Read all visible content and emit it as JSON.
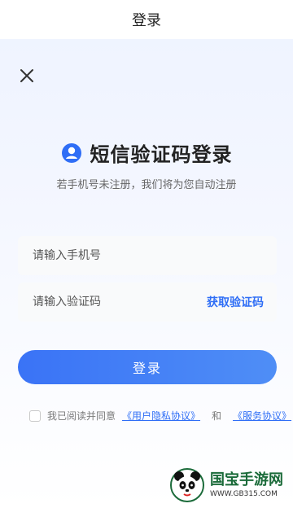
{
  "header": {
    "title": "登录"
  },
  "hero": {
    "title": "短信验证码登录",
    "subtitle": "若手机号未注册，我们将为您自动注册"
  },
  "form": {
    "phone_placeholder": "请输入手机号",
    "code_placeholder": "请输入验证码",
    "get_code_label": "获取验证码",
    "login_label": "登录"
  },
  "agreement": {
    "prefix": "我已阅读并同意",
    "privacy_link": "《用户隐私协议》",
    "and_text": "和",
    "service_link": "《服务协议》",
    "checked": false
  },
  "watermark": {
    "title": "国宝手游网",
    "url": "WWW.GB315.COM"
  },
  "icons": {
    "close": "close-icon",
    "user": "user-circle-icon",
    "panda_logo": "panda-logo-icon"
  },
  "colors": {
    "accent": "#2f6ef6",
    "button_gradient_start": "#3a73f6",
    "button_gradient_end": "#4f8ef6"
  }
}
